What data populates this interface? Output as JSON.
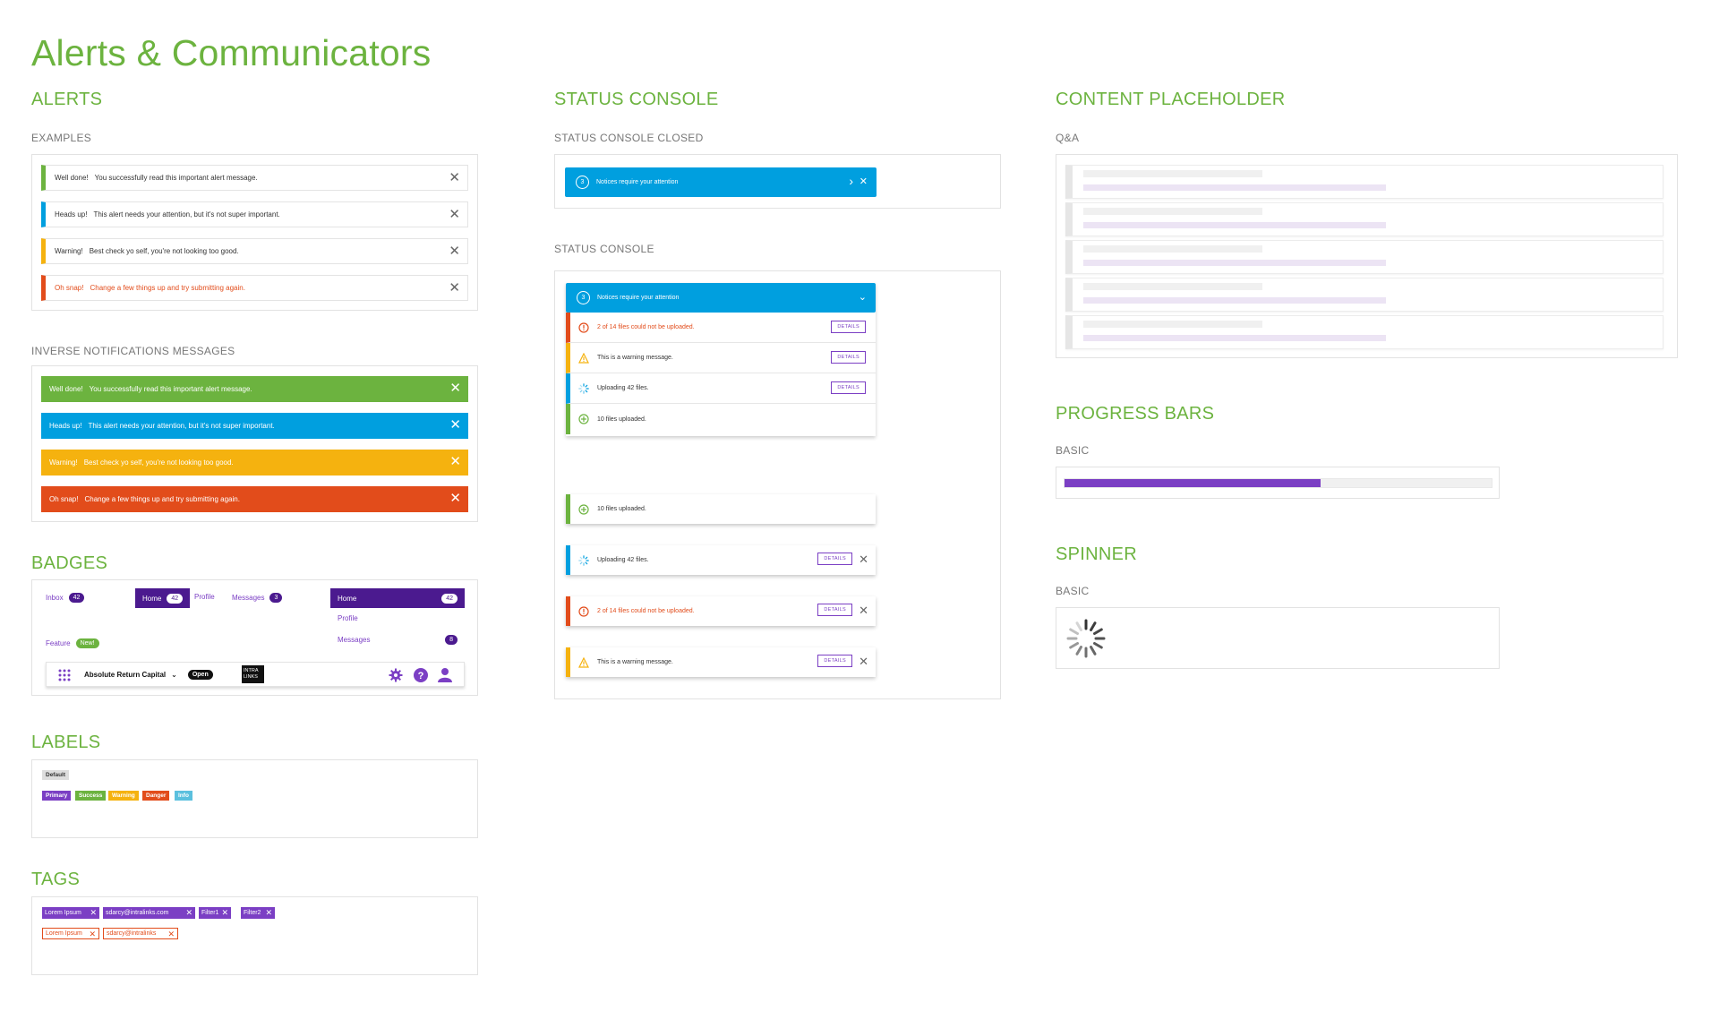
{
  "page": {
    "title": "Alerts & Communicators"
  },
  "colors": {
    "green": "#6cb33f",
    "blue": "#009fdf",
    "yellow": "#f5b20f",
    "red": "#e24c1b",
    "purple": "#7b3fc4",
    "dark_purple": "#4b1a8f"
  },
  "alerts": {
    "title": "ALERTS",
    "examples_label": "EXAMPLES",
    "examples": [
      {
        "strong": "Well done!",
        "text": "You successfully read this important alert message.",
        "close": "✕"
      },
      {
        "strong": "Heads up!",
        "text": "This alert needs your attention, but it's not super important.",
        "close": "✕"
      },
      {
        "strong": "Warning!",
        "text": "Best check yo self, you're not looking too good.",
        "close": "✕"
      },
      {
        "strong": "Oh snap!",
        "text": "Change a few things up and try submitting again.",
        "close": "✕"
      }
    ],
    "inverse_label": "INVERSE NOTIFICATIONS MESSAGES",
    "inverse": [
      {
        "strong": "Well done!",
        "text": "You successfully read this important alert message.",
        "close": "✕"
      },
      {
        "strong": "Heads up!",
        "text": "This alert needs your attention, but it's not super important.",
        "close": "✕"
      },
      {
        "strong": "Warning!",
        "text": "Best check yo self, you're not looking too good.",
        "close": "✕"
      },
      {
        "strong": "Oh snap!",
        "text": "Change a few things up and try submitting again.",
        "close": "✕"
      }
    ]
  },
  "badges": {
    "title": "BADGES",
    "inbox": {
      "label": "Inbox",
      "count": "42"
    },
    "home": {
      "label": "Home",
      "count": "42"
    },
    "profile": "Profile",
    "messages": {
      "label": "Messages",
      "count": "3"
    },
    "nav_home": {
      "label": "Home",
      "count": "42"
    },
    "nav_profile": "Profile",
    "nav_messages": {
      "label": "Messages",
      "count": "8"
    },
    "feature": {
      "label": "Feature",
      "badge": "New!"
    },
    "toolbar": {
      "name": "Absolute Return Capital",
      "status": "Open",
      "logo_line1": "INTRA",
      "logo_line2": "LINKS"
    }
  },
  "labels": {
    "title": "LABELS",
    "default": "Default",
    "items": [
      "Primary",
      "Success",
      "Warning",
      "Danger",
      "Info"
    ]
  },
  "tags": {
    "title": "TAGS",
    "filled": [
      "Lorem Ipsum",
      "sdarcy@intralinks.com",
      "Filter1",
      "Filter2"
    ],
    "outlined": [
      "Lorem Ipsum",
      "sdarcy@intralinks"
    ],
    "close": "✕"
  },
  "status_console": {
    "title": "STATUS CONSOLE",
    "closed_label": "STATUS CONSOLE CLOSED",
    "open_label": "STATUS CONSOLE",
    "count": "3",
    "header_text": "Notices require your attention",
    "details": "DETAILS",
    "rows": [
      {
        "text": "2 of 14 files could not be uploaded.",
        "has_details": true
      },
      {
        "text": "This is a warning message.",
        "has_details": true
      },
      {
        "text": "Uploading 42 files.",
        "has_details": true
      },
      {
        "text": "10 files uploaded.",
        "has_details": false
      }
    ],
    "cards": [
      {
        "text": "10 files uploaded.",
        "has_details": false
      },
      {
        "text": "Uploading 42 files.",
        "has_details": true
      },
      {
        "text": "2 of 14 files could not be uploaded.",
        "has_details": true
      },
      {
        "text": "This is a warning message.",
        "has_details": true
      }
    ],
    "close": "✕"
  },
  "placeholder": {
    "title": "CONTENT PLACEHOLDER",
    "sub": "Q&A"
  },
  "progress": {
    "title": "PROGRESS BARS",
    "sub": "BASIC",
    "value": 0.6
  },
  "spinner": {
    "title": "SPINNER",
    "sub": "BASIC"
  }
}
